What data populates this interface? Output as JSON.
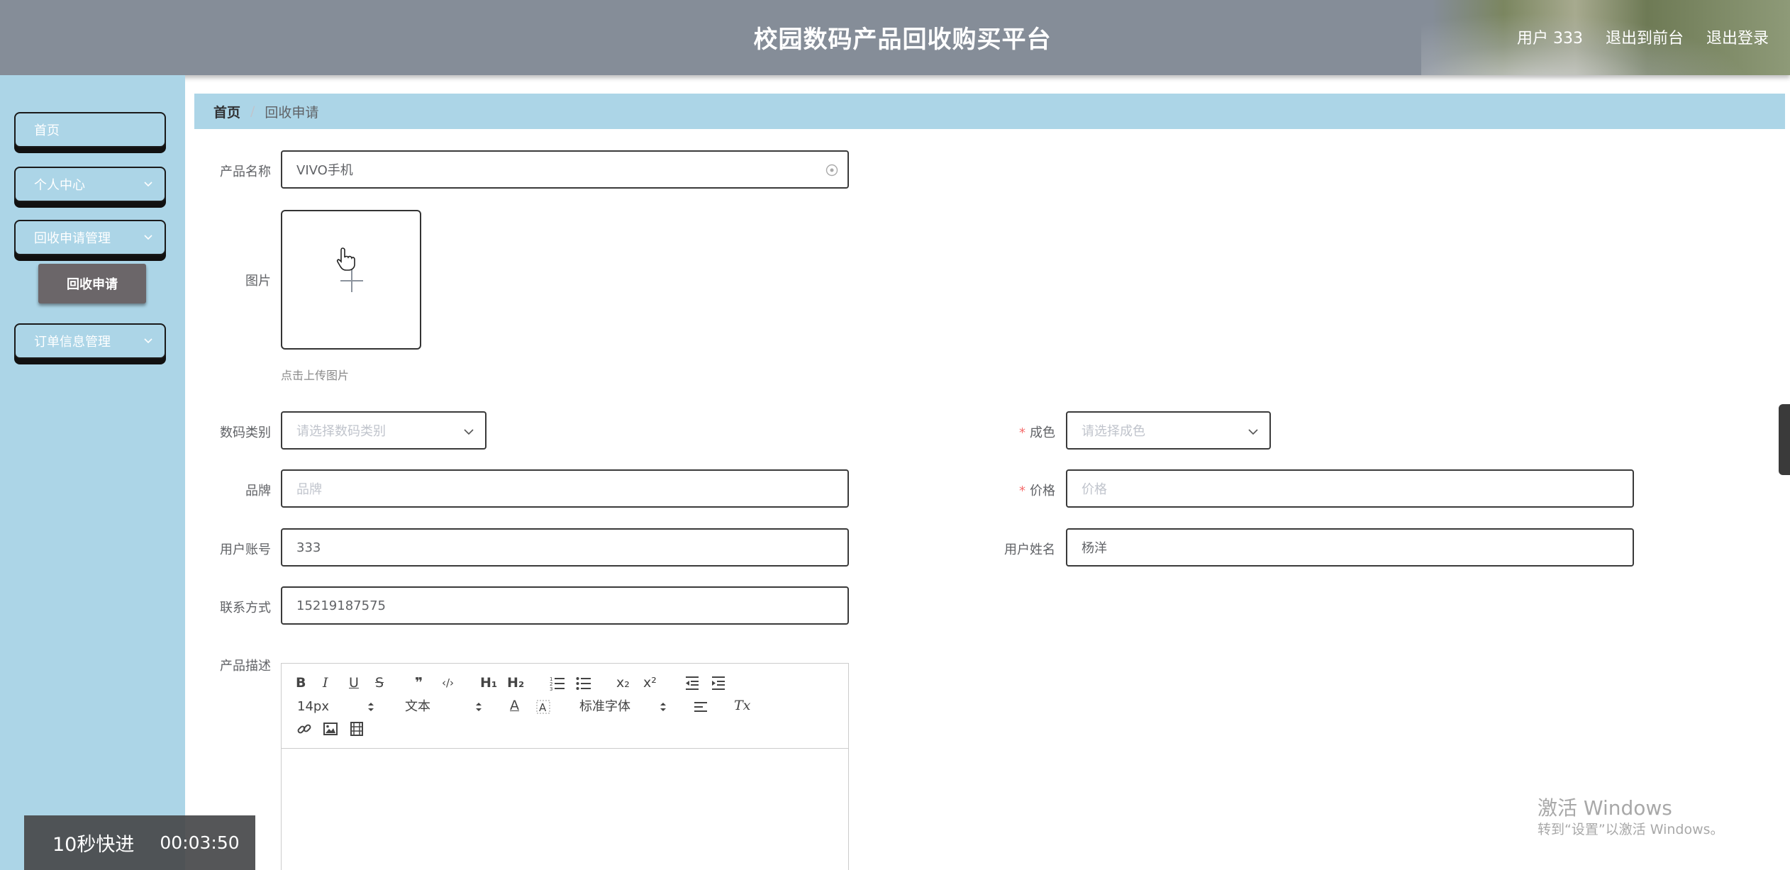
{
  "header": {
    "title": "校园数码产品回收购买平台",
    "user_label": "用户 333",
    "to_front": "退出到前台",
    "logout": "退出登录"
  },
  "sidebar": {
    "items": [
      {
        "label": "首页"
      },
      {
        "label": "个人中心"
      },
      {
        "label": "回收申请管理"
      },
      {
        "label": "订单信息管理"
      }
    ],
    "active_sub": "回收申请"
  },
  "breadcrumb": {
    "home": "首页",
    "separator": "/",
    "current": "回收申请"
  },
  "form": {
    "product_name": {
      "label": "产品名称",
      "value": "VIVO手机"
    },
    "image": {
      "label": "图片",
      "tip": "点击上传图片"
    },
    "category": {
      "label": "数码类别",
      "placeholder": "请选择数码类别"
    },
    "condition": {
      "label": "成色",
      "placeholder": "请选择成色",
      "required_mark": "*"
    },
    "brand": {
      "label": "品牌",
      "placeholder": "品牌"
    },
    "price": {
      "label": "价格",
      "placeholder": "价格",
      "required_mark": "*"
    },
    "account": {
      "label": "用户账号",
      "value": "333"
    },
    "user_name": {
      "label": "用户姓名",
      "value": "杨洋"
    },
    "contact": {
      "label": "联系方式",
      "value": "15219187575"
    },
    "description": {
      "label": "产品描述"
    }
  },
  "editor": {
    "bold": "B",
    "italic": "I",
    "underline": "U",
    "strike": "S",
    "quote": "❞",
    "code": "‹/›",
    "h1": "H₁",
    "h2": "H₂",
    "sub": "x₂",
    "sup": "x²",
    "font_size": "14px",
    "text_style": "文本",
    "font_family": "标准字体",
    "color": "A",
    "clean": "Tx"
  },
  "video": {
    "fast_forward": "10秒快进",
    "time": "00:03:50"
  },
  "watermark": {
    "line1": "激活 Windows",
    "line2": "转到“设置”以激活 Windows。"
  }
}
